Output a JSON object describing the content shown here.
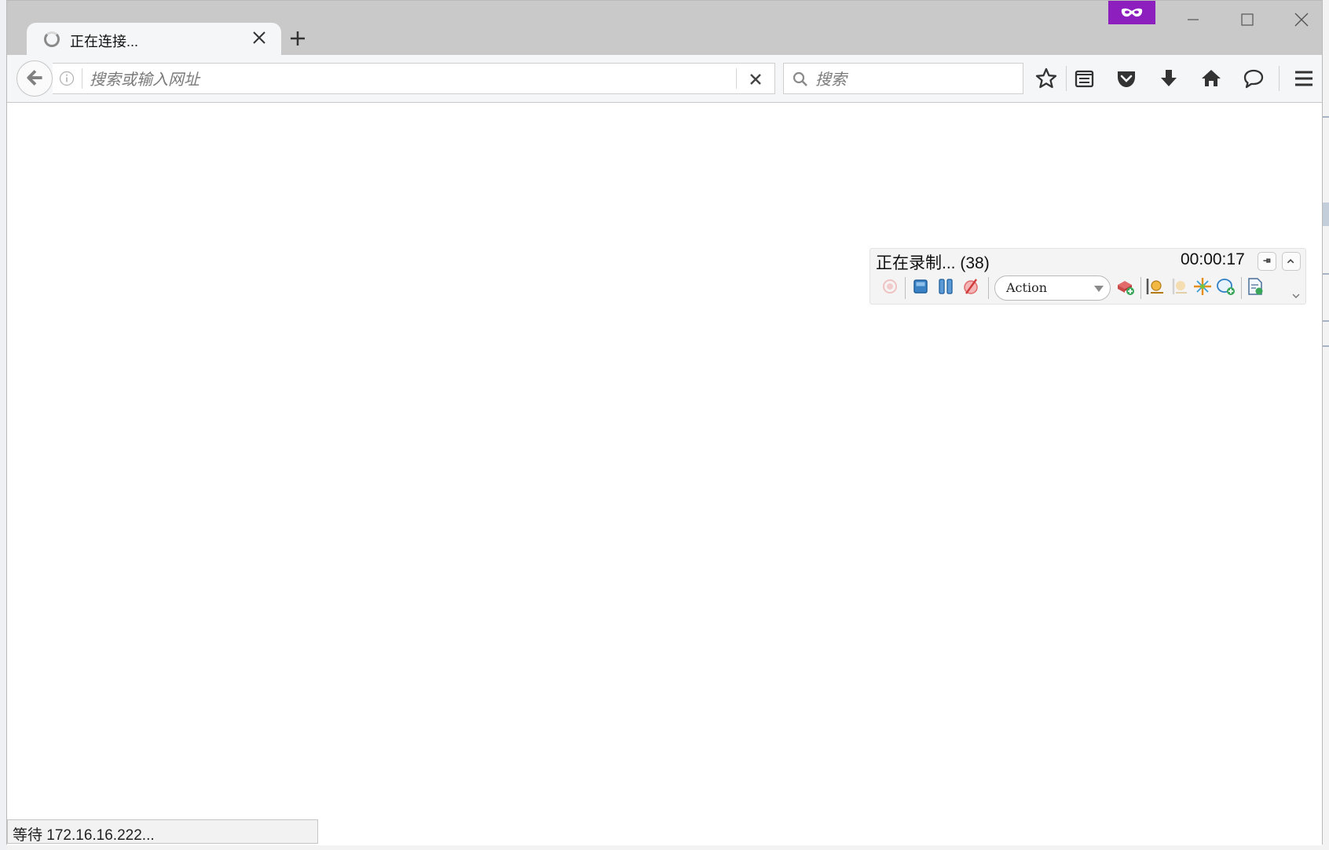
{
  "tab": {
    "title": "正在连接..."
  },
  "navbar": {
    "url_value": "",
    "url_placeholder": "搜索或输入网址",
    "search_value": "",
    "search_placeholder": "搜索"
  },
  "recorder": {
    "status": "正在录制... (38)",
    "timer": "00:00:17",
    "action_selected": "Action"
  },
  "statusbar": {
    "text": "等待 172.16.16.222..."
  },
  "colors": {
    "private_browsing_accent": "#8d1fbf",
    "tabbar_bg": "#c9c9c9",
    "toolbar_bg": "#f5f6f7"
  },
  "icons": [
    "loading-throbber-icon",
    "tab-close-icon",
    "new-tab-icon",
    "private-mask-icon",
    "minimize-icon",
    "maximize-icon",
    "close-icon",
    "back-arrow-icon",
    "info-icon",
    "clear-icon",
    "search-icon",
    "bookmark-star-icon",
    "reading-list-icon",
    "pocket-icon",
    "download-icon",
    "home-icon",
    "chat-icon",
    "hamburger-menu-icon",
    "record-icon",
    "stop-icon",
    "pause-icon",
    "disable-icon",
    "add-step-icon",
    "checkpoint-icon",
    "output-icon",
    "spy-icon",
    "add-object-icon",
    "document-icon"
  ]
}
